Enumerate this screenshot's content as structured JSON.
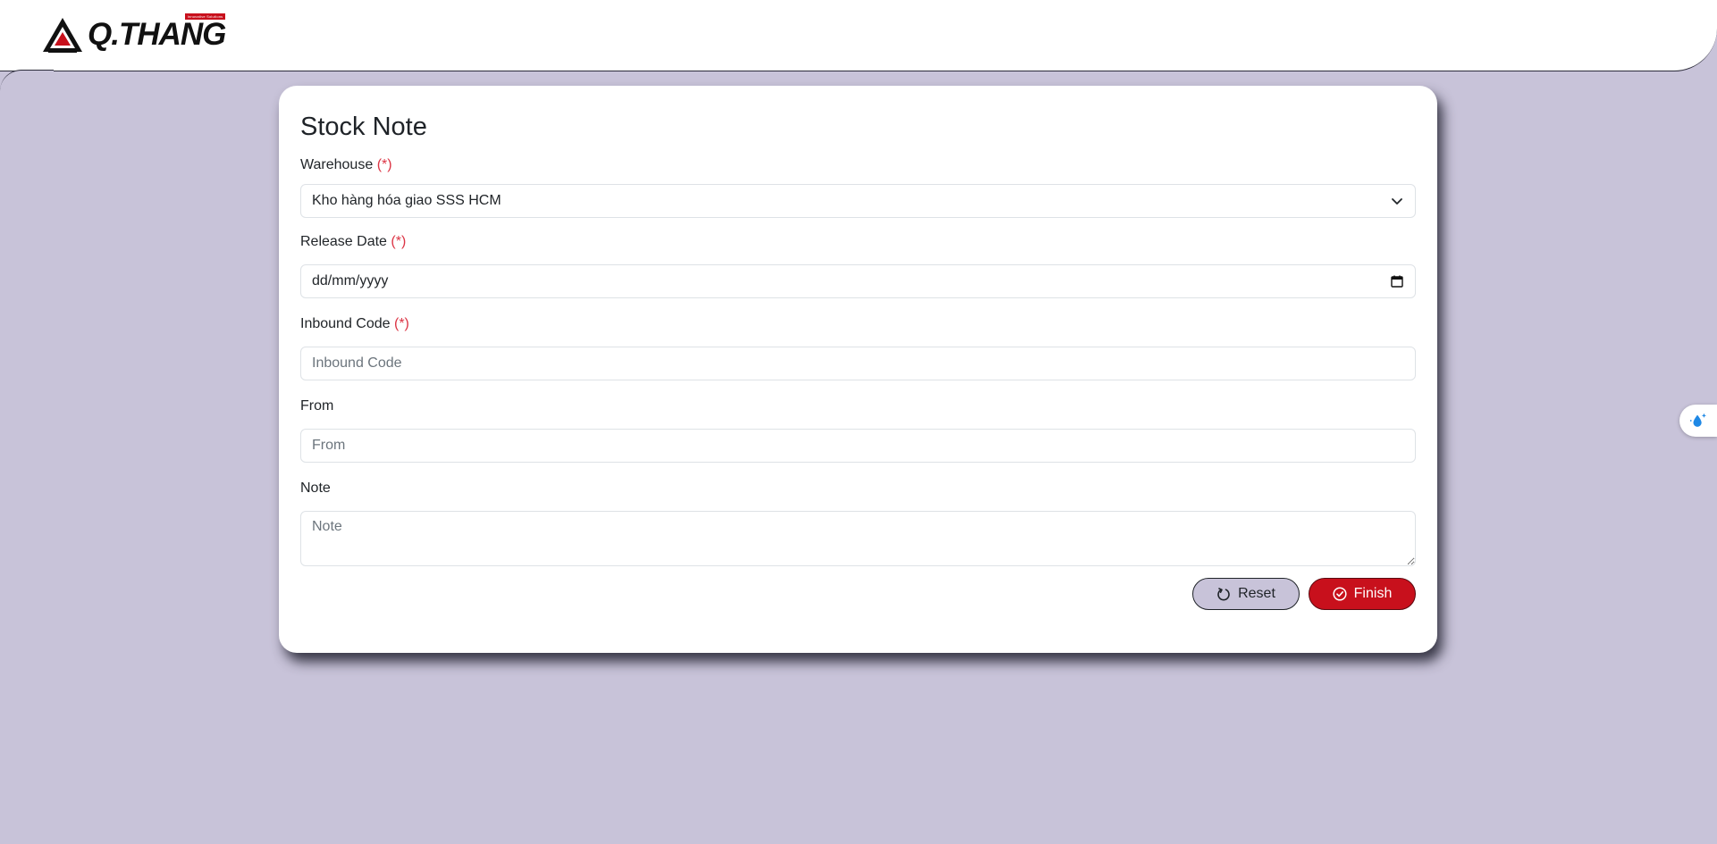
{
  "header": {
    "logo_text": "Q.THANG",
    "logo_tag": "Innovative Solutions"
  },
  "form": {
    "title": "Stock Note",
    "required_marker": "(*)",
    "warehouse": {
      "label": "Warehouse",
      "value": "Kho hàng hóa giao SSS HCM"
    },
    "release_date": {
      "label": "Release Date",
      "placeholder": "dd/mm/yyyy"
    },
    "inbound_code": {
      "label": "Inbound Code",
      "placeholder": "Inbound Code"
    },
    "from": {
      "label": "From",
      "placeholder": "From"
    },
    "note": {
      "label": "Note",
      "placeholder": "Note"
    },
    "actions": {
      "reset_label": "Reset",
      "finish_label": "Finish"
    }
  },
  "colors": {
    "background": "#c8c3d9",
    "accent": "#c8101c",
    "required": "#dc3545"
  },
  "icons": {
    "reset": "reset-icon",
    "finish": "check-circle-icon",
    "dropdown": "chevron-down-icon",
    "calendar": "calendar-icon",
    "side_widget": "water-drop-sparkle-icon"
  }
}
